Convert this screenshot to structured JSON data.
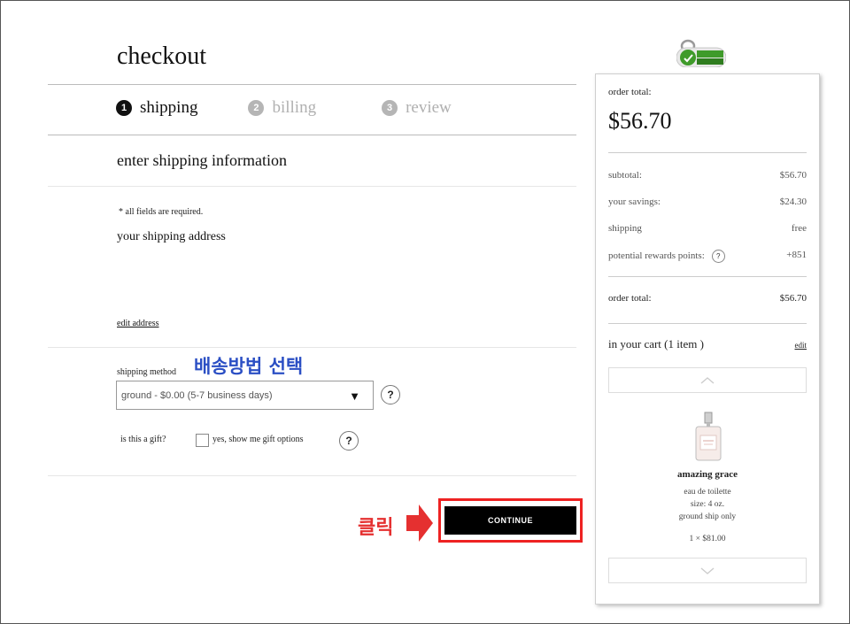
{
  "page": {
    "title": "checkout"
  },
  "steps": [
    {
      "num": "1",
      "label": "shipping",
      "active": true
    },
    {
      "num": "2",
      "label": "billing",
      "active": false
    },
    {
      "num": "3",
      "label": "review",
      "active": false
    }
  ],
  "shipping": {
    "section_title": "enter shipping information",
    "required_note": "* all fields are required.",
    "address_heading": "your shipping address",
    "edit_address": "edit address",
    "method_label": "shipping method",
    "method_selected": "ground - $0.00 (5-7 business days)",
    "help_glyph": "?",
    "gift_question": "is this a gift?",
    "gift_option": "yes, show me gift options"
  },
  "actions": {
    "continue": "CONTINUE"
  },
  "annotations": {
    "select_method": "배송방법 선택",
    "click": "클릭",
    "highlight_color": "#e22222",
    "korean_color": "#2b4fc4"
  },
  "badge": {
    "icon": "comodo-secure-badge"
  },
  "summary": {
    "order_total_label": "order total:",
    "order_total_value": "$56.70",
    "subtotal_label": "subtotal:",
    "subtotal_value": "$56.70",
    "savings_label": "your savings:",
    "savings_value": "$24.30",
    "shipping_label": "shipping",
    "shipping_value": "free",
    "rewards_label": "potential rewards points:",
    "rewards_value": "+851",
    "total_label": "order total:",
    "total_value": "$56.70",
    "cart_heading": "in your cart (1 item )",
    "cart_edit": "edit"
  },
  "cart_item": {
    "name": "amazing grace",
    "type": "eau de toilette",
    "size": "size: 4 oz.",
    "ship_note": "ground ship only",
    "qty_price": "1 × $81.00",
    "image_icon": "perfume-bottle-icon"
  }
}
